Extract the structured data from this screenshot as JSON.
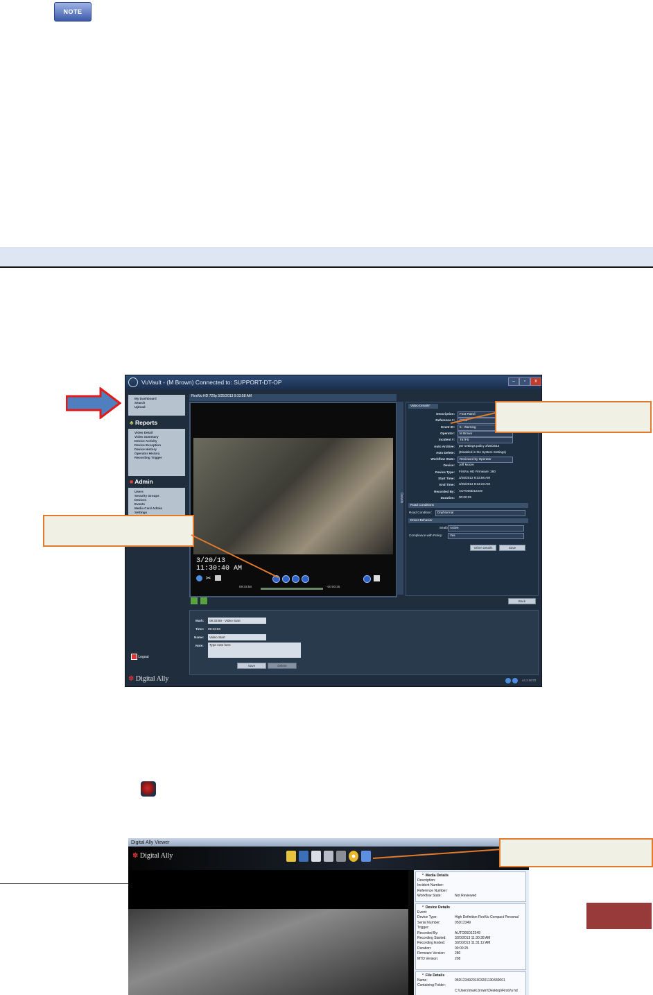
{
  "note": {
    "label": "NOTE"
  },
  "vuvault": {
    "title": "VuVault - (M Brown) Connected to: SUPPORT-DT-OP",
    "nav_top": [
      "My Dashboard",
      "Search",
      "Upload"
    ],
    "reports_heading": "Reports",
    "reports": [
      "Video Detail",
      "Video Summary",
      "Device Activity",
      "Device Exception",
      "Device History",
      "Operator History",
      "Recording Trigger"
    ],
    "admin_heading": "Admin",
    "admin": [
      "Users",
      "Security Groups",
      "Devices",
      "Events",
      "Media Card Admin",
      "Settings",
      "WiteLite Settings",
      "Workstation Settings"
    ],
    "logout": "Logout",
    "brand": "Digital Ally",
    "video_panel_title": "FirstVu HD 720p   3/25/2013 9:33:58 AM",
    "overlay_date": "3/20/13",
    "overlay_time": "11:30:40 AM",
    "time_start": "09:33:58",
    "time_end": "-00:00:25",
    "details_tab": "Details",
    "details_header": "Video Details*",
    "details": [
      {
        "label": "Description:",
        "value": "Foot Patrol"
      },
      {
        "label": "Reference #:",
        "value": "C345"
      },
      {
        "label": "Event ID:",
        "value": "5 - Warning"
      },
      {
        "label": "Operator:",
        "value": "M Brown"
      },
      {
        "label": "Incident #:",
        "value": "T67F5"
      },
      {
        "label": "Auto Archive:",
        "value": "per settings policy   3/25/2014"
      },
      {
        "label": "Auto Delete:",
        "value": "(Disabled in the System Settings)"
      },
      {
        "label": "Workflow State:",
        "value": "Reviewed by Operator"
      },
      {
        "label": "Device:",
        "value": "Jeff Moore"
      },
      {
        "label": "Device Type:",
        "value": "FirstVu HD    Firmware:   280"
      },
      {
        "label": "Start Time:",
        "value": "3/25/2013 9:33:56 AM"
      },
      {
        "label": "End Time:",
        "value": "3/25/2013 9:34:23 AM"
      },
      {
        "label": "Recorded By:",
        "value": "AUTO05D12349"
      },
      {
        "label": "Duration:",
        "value": "00:00:25"
      }
    ],
    "road_header": "Road Conditions",
    "road_label": "Road Condition:",
    "road_value": "Dry/Normal",
    "driver_header": "Driver Behavior",
    "seatbelt_label": "Seatbelt:",
    "seatbelt_value": "Active",
    "policy_label": "Compliance with Policy:",
    "policy_value": "Yes",
    "other_details": "Other Details",
    "save": "Save",
    "back": "Back",
    "mark_label": "Mark:",
    "mark_value": "09:33:58 - Video Start",
    "time_label": "Time:",
    "time_value": "09:33:58",
    "name_label": "Name:",
    "name_value": "Video Start",
    "note_label": "Note:",
    "note_placeholder": "Type note here",
    "delete": "Delete",
    "version": "v4.2.8070"
  },
  "viewer": {
    "title": "Digital Ally Viewer",
    "brand": "Digital Ally",
    "media_header": "Media Details",
    "media": [
      {
        "k": "Description:",
        "v": ""
      },
      {
        "k": "Incident Number:",
        "v": ""
      },
      {
        "k": "Reference Number:",
        "v": ""
      },
      {
        "k": "Workflow State:",
        "v": "Not Reviewed"
      }
    ],
    "device_header": "Device Details",
    "device": [
      {
        "k": "Event:",
        "v": ""
      },
      {
        "k": "Device Type:",
        "v": "High Definition FirstVu Compact Personal"
      },
      {
        "k": "Serial Number:",
        "v": "05D12349"
      },
      {
        "k": "Trigger:",
        "v": ""
      },
      {
        "k": "Recorded By:",
        "v": "AUTO05D12349"
      },
      {
        "k": "Recording Started:",
        "v": "3/20/2013 11:30:38 AM"
      },
      {
        "k": "Recording Ended:",
        "v": "3/20/2013 11:31:12 AM"
      },
      {
        "k": "Duration:",
        "v": "00:00:25"
      },
      {
        "k": "Firmware Version:",
        "v": "280"
      },
      {
        "k": "MTD Version:",
        "v": "208"
      }
    ],
    "file_header": "File Details",
    "file": [
      {
        "k": "Name:",
        "v": "05D12349201303201130430001"
      },
      {
        "k": "Containing Folder:",
        "v": ""
      },
      {
        "k": "",
        "v": "C:\\Users\\mark.brown\\Desktop\\FirstVu hd"
      }
    ]
  },
  "colors": {
    "callout_border": "#e07a2d",
    "callout_fill": "#f1f0e4",
    "arrow_red": "#e01b1b",
    "arrow_blue": "#4f7fbf",
    "footer_block": "#983a3a"
  }
}
